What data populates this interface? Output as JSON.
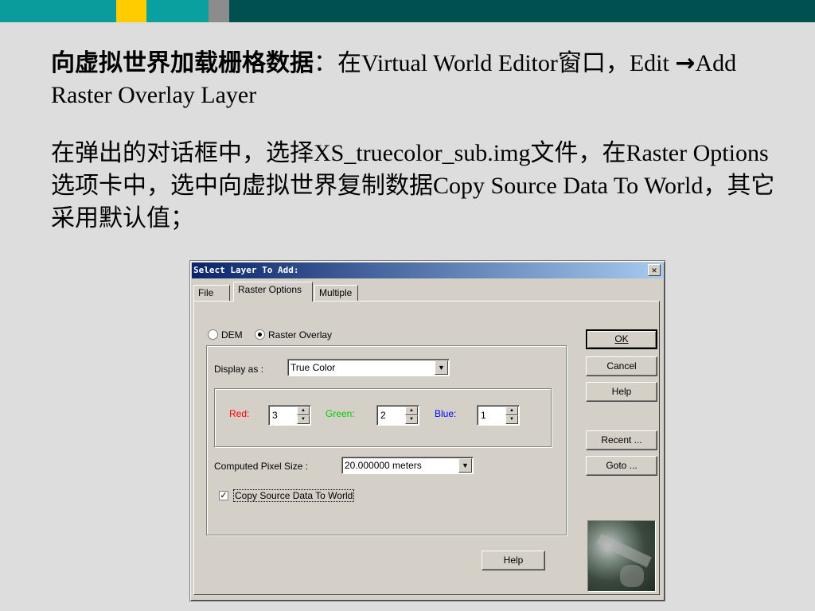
{
  "slide": {
    "para1_bold": "向虚拟世界加载栅格数据",
    "para1_rest": "：在Virtual World Editor窗口，Edit ",
    "para1_arrow": "→",
    "para1_end": "Add Raster Overlay Layer",
    "para2": "在弹出的对话框中，选择XS_truecolor_sub.img文件，在Raster Options选项卡中，选中向虚拟世界复制数据Copy Source Data To World，其它采用默认值；"
  },
  "dialog": {
    "title": "Select Layer To Add:",
    "close": "✕",
    "tabs": [
      "File",
      "Raster Options",
      "Multiple"
    ],
    "active_tab": "Raster Options",
    "radios": [
      {
        "label": "DEM",
        "checked": false
      },
      {
        "label": "Raster Overlay",
        "checked": true
      }
    ],
    "display_as_label": "Display as :",
    "display_as_value": "True Color",
    "red_label": "Red:",
    "red_value": "3",
    "green_label": "Green:",
    "green_value": "2",
    "blue_label": "Blue:",
    "blue_value": "1",
    "pixel_size_label": "Computed Pixel Size :",
    "pixel_size_value": "20.000000 meters",
    "copy_label": "Copy Source Data To World",
    "copy_checked": true,
    "buttons": {
      "ok": "OK",
      "cancel": "Cancel",
      "help": "Help",
      "recent": "Recent ...",
      "goto": "Goto ...",
      "help_bottom": "Help"
    },
    "colors": {
      "red": "#ff0000",
      "green": "#00cc00",
      "blue": "#0000ff"
    }
  }
}
